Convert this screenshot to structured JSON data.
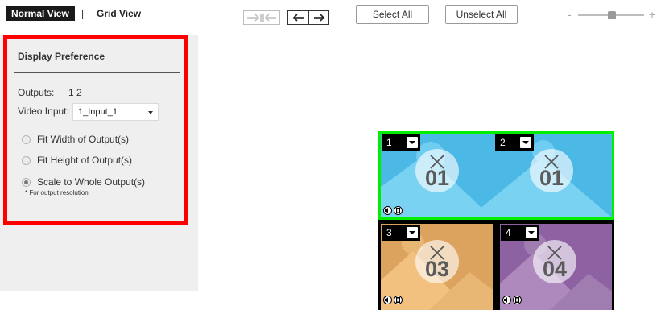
{
  "toolbar": {
    "normal_view": "Normal View",
    "separator": "|",
    "grid_view": "Grid View",
    "select_all": "Select All",
    "unselect_all": "Unselect All",
    "zoom_minus": "-",
    "zoom_plus": "+",
    "zoom_level": 0.5,
    "icons": [
      "collapse-arrows-icon",
      "expand-arrows-icon"
    ]
  },
  "panel": {
    "title": "Display Preference",
    "outputs_label": "Outputs:",
    "outputs_value": "1 2",
    "video_input_label": "Video Input:",
    "video_input_value": "1_Input_1",
    "options": [
      {
        "label": "Fit Width of Output(s)",
        "checked": false
      },
      {
        "label": "Fit Height of Output(s)",
        "checked": false
      },
      {
        "label": "Scale to Whole Output(s)",
        "checked": true
      }
    ],
    "note": "* For output resolution",
    "highlight_color": "#ff0000"
  },
  "wall": {
    "selection_color": "#00ee00",
    "tiles": [
      {
        "output": "1",
        "source": "01",
        "color": "#4cb8e6"
      },
      {
        "output": "2",
        "source": "01",
        "color": "#4cb8e6"
      },
      {
        "output": "3",
        "source": "03",
        "color": "#dca35e"
      },
      {
        "output": "4",
        "source": "04",
        "color": "#8e62a2"
      }
    ],
    "tile_icons": [
      "speaker-icon",
      "film-icon"
    ]
  }
}
